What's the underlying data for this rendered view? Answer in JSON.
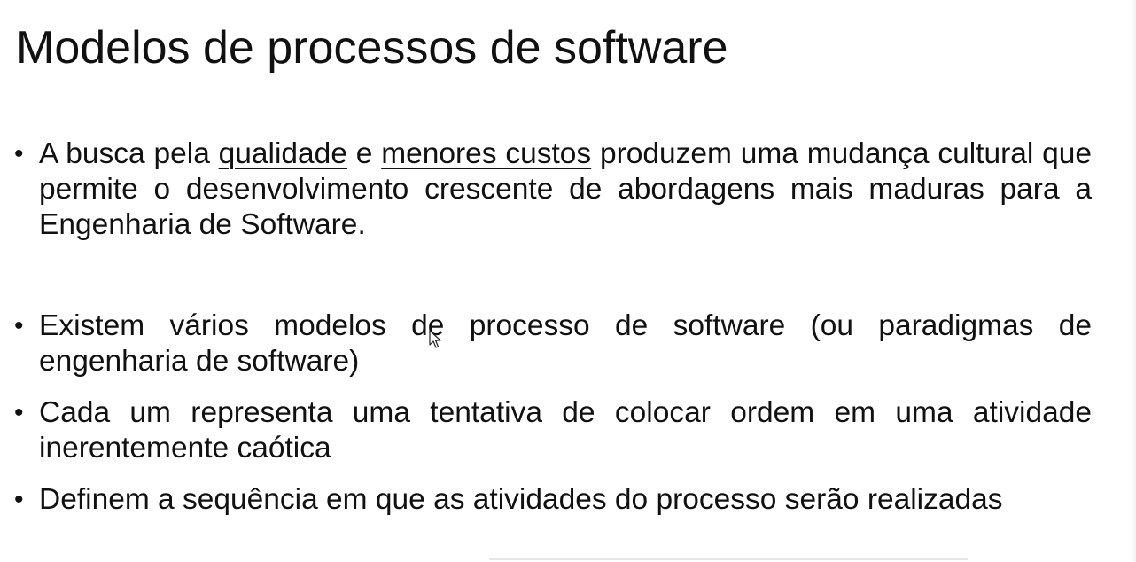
{
  "slide": {
    "title": "Modelos de processos de software",
    "bullets": [
      {
        "parts": [
          {
            "text": "A busca pela ",
            "underline": false
          },
          {
            "text": "qualidade",
            "underline": true
          },
          {
            "text": " e ",
            "underline": false
          },
          {
            "text": "menores custos",
            "underline": true
          },
          {
            "text": " produzem uma mudança cultural que permite o desenvolvimento crescente de abordagens mais maduras para a Engenharia de Software.",
            "underline": false
          }
        ]
      },
      {
        "parts": [
          {
            "text": "Existem vários modelos de processo de software (ou paradigmas de engenharia de software)",
            "underline": false
          }
        ]
      },
      {
        "parts": [
          {
            "text": "Cada um representa uma tentativa de colocar ordem em uma atividade inerentemente caótica",
            "underline": false
          }
        ]
      },
      {
        "parts": [
          {
            "text": "Definem a sequência em que as atividades do processo serão realizadas",
            "underline": false
          }
        ]
      }
    ],
    "bullet_glyph": "•"
  },
  "colors": {
    "background": "#ffffff",
    "text": "#111111"
  },
  "icons": {
    "cursor": "mouse-pointer-icon"
  }
}
